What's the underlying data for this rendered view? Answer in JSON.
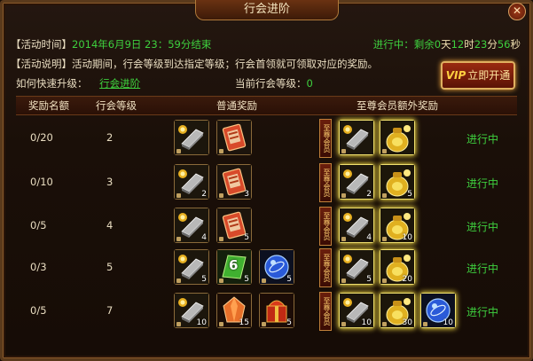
{
  "window": {
    "title": "行会进阶",
    "close_glyph": "✕"
  },
  "info": {
    "time_label": "【活动时间】",
    "time_value": "2014年6月9日 23：59分结束",
    "desc_label": "【活动说明】",
    "desc_value": "活动期间，行会等级到达指定等级；行会首领就可领取对应的奖励。",
    "upgrade_label": "如何快速升级：",
    "upgrade_link": "行会进阶",
    "current_level_label": "当前行会等级：",
    "current_level_value": "0"
  },
  "countdown": {
    "prefix": "进行中：剩余",
    "days": "0",
    "days_unit": "天",
    "hours": "12",
    "hours_unit": "时",
    "minutes": "23",
    "minutes_unit": "分",
    "seconds": "56",
    "seconds_unit": "秒"
  },
  "vip_button": {
    "prefix": "VIP",
    "label": "立即开通"
  },
  "table": {
    "headers": [
      "奖励名额",
      "行会等级",
      "普通奖励",
      "至尊会员额外奖励"
    ],
    "vip_tag": "至尊会员",
    "rows": [
      {
        "quota": "0/20",
        "level": "2",
        "status": "进行中",
        "normal": [
          {
            "icon": "silver-ingot",
            "count": ""
          },
          {
            "icon": "red-scroll",
            "count": ""
          }
        ],
        "vip": [
          {
            "icon": "silver-ingot",
            "count": ""
          },
          {
            "icon": "gold-bag",
            "count": ""
          }
        ]
      },
      {
        "quota": "0/10",
        "level": "3",
        "status": "进行中",
        "normal": [
          {
            "icon": "silver-ingot",
            "count": "2"
          },
          {
            "icon": "red-scroll",
            "count": "3"
          }
        ],
        "vip": [
          {
            "icon": "silver-ingot",
            "count": "2"
          },
          {
            "icon": "gold-bag",
            "count": "5"
          }
        ]
      },
      {
        "quota": "0/5",
        "level": "4",
        "status": "进行中",
        "normal": [
          {
            "icon": "silver-ingot",
            "count": "4"
          },
          {
            "icon": "red-scroll",
            "count": "5"
          }
        ],
        "vip": [
          {
            "icon": "silver-ingot",
            "count": "4"
          },
          {
            "icon": "gold-bag",
            "count": "10"
          }
        ]
      },
      {
        "quota": "0/3",
        "level": "5",
        "status": "进行中",
        "normal": [
          {
            "icon": "silver-ingot",
            "count": "5"
          },
          {
            "icon": "green-six-token",
            "count": "5"
          },
          {
            "icon": "blue-orb",
            "count": "5"
          }
        ],
        "vip": [
          {
            "icon": "silver-ingot",
            "count": "5"
          },
          {
            "icon": "gold-bag",
            "count": "20"
          }
        ]
      },
      {
        "quota": "0/5",
        "level": "7",
        "status": "进行中",
        "normal": [
          {
            "icon": "silver-ingot",
            "count": "10"
          },
          {
            "icon": "orange-gem",
            "count": "15"
          },
          {
            "icon": "red-gift-box",
            "count": "5"
          }
        ],
        "vip": [
          {
            "icon": "silver-ingot",
            "count": "10"
          },
          {
            "icon": "gold-bag",
            "count": "30"
          },
          {
            "icon": "blue-orb",
            "count": "10"
          }
        ]
      }
    ]
  },
  "token_digit": "6",
  "colors": {
    "accent_green": "#3ed03e",
    "frame_gold": "#b07a3a",
    "bg": "#1a0f08"
  }
}
